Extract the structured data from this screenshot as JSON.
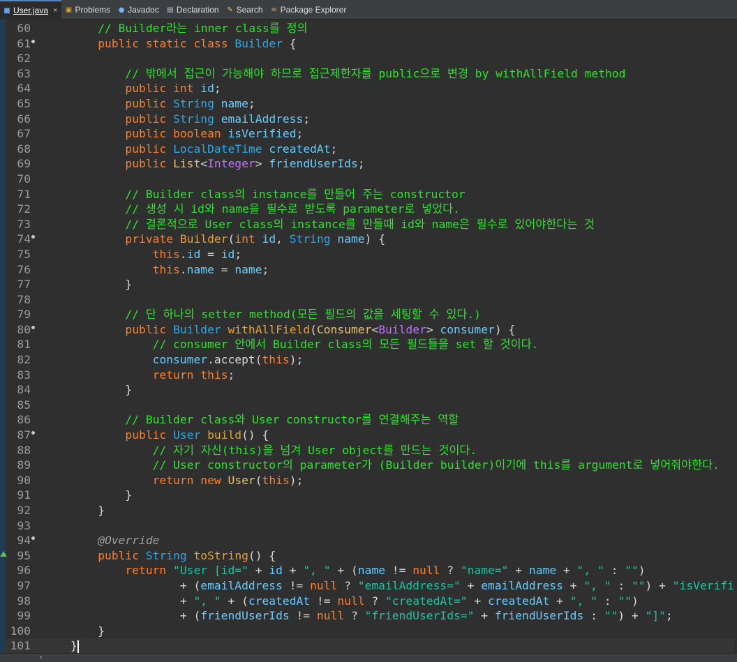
{
  "tabs": [
    {
      "label": "User.java",
      "icon": "java-file-icon",
      "active": true,
      "closable": true
    },
    {
      "label": "Problems",
      "icon": "problems-icon"
    },
    {
      "label": "Javadoc",
      "icon": "javadoc-icon"
    },
    {
      "label": "Declaration",
      "icon": "declaration-icon"
    },
    {
      "label": "Search",
      "icon": "search-icon"
    },
    {
      "label": "Package Explorer",
      "icon": "package-explorer-icon"
    }
  ],
  "colors": {
    "comment": "#30e230",
    "keyword": "#ff7f2a",
    "type": "#2aa9e8",
    "field": "#66ccff",
    "method": "#e8a230",
    "string": "#17c6a3",
    "annotation": "#a0a0a0",
    "generic": "#c070ff",
    "background": "#2f2f2f"
  },
  "editor": {
    "lines": [
      {
        "num": "60",
        "tokens": [
          [
            "    ",
            "p"
          ],
          [
            "// Builder라는 inner class를 정의",
            "cm"
          ]
        ]
      },
      {
        "num": "61",
        "fold": true,
        "tokens": [
          [
            "    ",
            "p"
          ],
          [
            "public",
            "kw"
          ],
          [
            " ",
            "p"
          ],
          [
            "static",
            "kw"
          ],
          [
            " ",
            "p"
          ],
          [
            "class",
            "kw"
          ],
          [
            " ",
            "p"
          ],
          [
            "Builder",
            "ty"
          ],
          [
            " {",
            "p"
          ]
        ]
      },
      {
        "num": "62",
        "tokens": []
      },
      {
        "num": "63",
        "tokens": [
          [
            "        ",
            "p"
          ],
          [
            "// 밖에서 접근이 가능해야 하므로 접근제한자를 public으로 변경 by withAllField method",
            "cm"
          ]
        ]
      },
      {
        "num": "64",
        "tokens": [
          [
            "        ",
            "p"
          ],
          [
            "public",
            "kw"
          ],
          [
            " ",
            "p"
          ],
          [
            "int",
            "kw"
          ],
          [
            " ",
            "p"
          ],
          [
            "id",
            "fd"
          ],
          [
            ";",
            "p"
          ]
        ]
      },
      {
        "num": "65",
        "tokens": [
          [
            "        ",
            "p"
          ],
          [
            "public",
            "kw"
          ],
          [
            " ",
            "p"
          ],
          [
            "String",
            "ty"
          ],
          [
            " ",
            "p"
          ],
          [
            "name",
            "fd"
          ],
          [
            ";",
            "p"
          ]
        ]
      },
      {
        "num": "66",
        "tokens": [
          [
            "        ",
            "p"
          ],
          [
            "public",
            "kw"
          ],
          [
            " ",
            "p"
          ],
          [
            "String",
            "ty"
          ],
          [
            " ",
            "p"
          ],
          [
            "emailAddress",
            "fd"
          ],
          [
            ";",
            "p"
          ]
        ]
      },
      {
        "num": "67",
        "tokens": [
          [
            "        ",
            "p"
          ],
          [
            "public",
            "kw"
          ],
          [
            " ",
            "p"
          ],
          [
            "boolean",
            "kw"
          ],
          [
            " ",
            "p"
          ],
          [
            "isVerified",
            "fd"
          ],
          [
            ";",
            "p"
          ]
        ]
      },
      {
        "num": "68",
        "tokens": [
          [
            "        ",
            "p"
          ],
          [
            "public",
            "kw"
          ],
          [
            " ",
            "p"
          ],
          [
            "LocalDateTime",
            "ty"
          ],
          [
            " ",
            "p"
          ],
          [
            "createdAt",
            "fd"
          ],
          [
            ";",
            "p"
          ]
        ]
      },
      {
        "num": "69",
        "tokens": [
          [
            "        ",
            "p"
          ],
          [
            "public",
            "kw"
          ],
          [
            " ",
            "p"
          ],
          [
            "List",
            "cl"
          ],
          [
            "<",
            "p"
          ],
          [
            "Integer",
            "gn"
          ],
          [
            "> ",
            "p"
          ],
          [
            "friendUserIds",
            "fd"
          ],
          [
            ";",
            "p"
          ]
        ]
      },
      {
        "num": "70",
        "tokens": []
      },
      {
        "num": "71",
        "tokens": [
          [
            "        ",
            "p"
          ],
          [
            "// Builder class의 instance를 만들어 주는 constructor",
            "cm"
          ]
        ]
      },
      {
        "num": "72",
        "tokens": [
          [
            "        ",
            "p"
          ],
          [
            "// 생성 시 id와 name을 필수로 받도록 parameter로 넣었다.",
            "cm"
          ]
        ]
      },
      {
        "num": "73",
        "tokens": [
          [
            "        ",
            "p"
          ],
          [
            "// 결론적으로 User class의 instance를 만들때 id와 name은 필수로 있어야한다는 것",
            "cm"
          ]
        ]
      },
      {
        "num": "74",
        "fold": true,
        "tokens": [
          [
            "        ",
            "p"
          ],
          [
            "private",
            "kw"
          ],
          [
            " ",
            "p"
          ],
          [
            "Builder",
            "fn"
          ],
          [
            "(",
            "p"
          ],
          [
            "int",
            "kw"
          ],
          [
            " ",
            "p"
          ],
          [
            "id",
            "fd"
          ],
          [
            ", ",
            "p"
          ],
          [
            "String",
            "ty"
          ],
          [
            " ",
            "p"
          ],
          [
            "name",
            "fd"
          ],
          [
            ") {",
            "p"
          ]
        ]
      },
      {
        "num": "75",
        "tokens": [
          [
            "            ",
            "p"
          ],
          [
            "this",
            "kw"
          ],
          [
            ".",
            "p"
          ],
          [
            "id",
            "fd"
          ],
          [
            " = ",
            "p"
          ],
          [
            "id",
            "fd"
          ],
          [
            ";",
            "p"
          ]
        ]
      },
      {
        "num": "76",
        "tokens": [
          [
            "            ",
            "p"
          ],
          [
            "this",
            "kw"
          ],
          [
            ".",
            "p"
          ],
          [
            "name",
            "fd"
          ],
          [
            " = ",
            "p"
          ],
          [
            "name",
            "fd"
          ],
          [
            ";",
            "p"
          ]
        ]
      },
      {
        "num": "77",
        "tokens": [
          [
            "        }",
            "p"
          ]
        ]
      },
      {
        "num": "78",
        "tokens": []
      },
      {
        "num": "79",
        "tokens": [
          [
            "        ",
            "p"
          ],
          [
            "// 단 하나의 setter method(모든 필드의 값을 세팅할 수 있다.)",
            "cm"
          ]
        ]
      },
      {
        "num": "80",
        "fold": true,
        "tokens": [
          [
            "        ",
            "p"
          ],
          [
            "public",
            "kw"
          ],
          [
            " ",
            "p"
          ],
          [
            "Builder",
            "ty"
          ],
          [
            " ",
            "p"
          ],
          [
            "withAllField",
            "fn"
          ],
          [
            "(",
            "p"
          ],
          [
            "Consumer",
            "cl"
          ],
          [
            "<",
            "p"
          ],
          [
            "Builder",
            "gn"
          ],
          [
            "> ",
            "p"
          ],
          [
            "consumer",
            "fd"
          ],
          [
            ") {",
            "p"
          ]
        ]
      },
      {
        "num": "81",
        "tokens": [
          [
            "            ",
            "p"
          ],
          [
            "// consumer 안에서 Builder class의 모든 필드들을 set 할 것이다.",
            "cm"
          ]
        ]
      },
      {
        "num": "82",
        "tokens": [
          [
            "            ",
            "p"
          ],
          [
            "consumer",
            "fd"
          ],
          [
            ".accept(",
            "p"
          ],
          [
            "this",
            "kw"
          ],
          [
            ");",
            "p"
          ]
        ]
      },
      {
        "num": "83",
        "tokens": [
          [
            "            ",
            "p"
          ],
          [
            "return",
            "kw"
          ],
          [
            " ",
            "p"
          ],
          [
            "this",
            "kw"
          ],
          [
            ";",
            "p"
          ]
        ]
      },
      {
        "num": "84",
        "tokens": [
          [
            "        }",
            "p"
          ]
        ]
      },
      {
        "num": "85",
        "tokens": []
      },
      {
        "num": "86",
        "tokens": [
          [
            "        ",
            "p"
          ],
          [
            "// Builder class와 User constructor를 연결해주는 역할",
            "cm"
          ]
        ]
      },
      {
        "num": "87",
        "fold": true,
        "tokens": [
          [
            "        ",
            "p"
          ],
          [
            "public",
            "kw"
          ],
          [
            " ",
            "p"
          ],
          [
            "User",
            "ty"
          ],
          [
            " ",
            "p"
          ],
          [
            "build",
            "fn"
          ],
          [
            "() {",
            "p"
          ]
        ]
      },
      {
        "num": "88",
        "tokens": [
          [
            "            ",
            "p"
          ],
          [
            "// 자기 자신(this)을 넘겨 User object를 만드는 것이다.",
            "cm"
          ]
        ]
      },
      {
        "num": "89",
        "tokens": [
          [
            "            ",
            "p"
          ],
          [
            "// User constructor의 parameter가 (Builder builder)이기에 this를 argument로 넣어줘야한다.",
            "cm"
          ]
        ]
      },
      {
        "num": "90",
        "tokens": [
          [
            "            ",
            "p"
          ],
          [
            "return",
            "kw"
          ],
          [
            " ",
            "p"
          ],
          [
            "new",
            "kw"
          ],
          [
            " ",
            "p"
          ],
          [
            "User",
            "cl"
          ],
          [
            "(",
            "p"
          ],
          [
            "this",
            "kw"
          ],
          [
            ");",
            "p"
          ]
        ]
      },
      {
        "num": "91",
        "tokens": [
          [
            "        }",
            "p"
          ]
        ]
      },
      {
        "num": "92",
        "tokens": [
          [
            "    }",
            "p"
          ]
        ]
      },
      {
        "num": "93",
        "tokens": []
      },
      {
        "num": "94",
        "fold": true,
        "tokens": [
          [
            "    ",
            "p"
          ],
          [
            "@Override",
            "an"
          ]
        ]
      },
      {
        "num": "95",
        "override": true,
        "tokens": [
          [
            "    ",
            "p"
          ],
          [
            "public",
            "kw"
          ],
          [
            " ",
            "p"
          ],
          [
            "String",
            "ty"
          ],
          [
            " ",
            "p"
          ],
          [
            "toString",
            "fn"
          ],
          [
            "() {",
            "p"
          ]
        ]
      },
      {
        "num": "96",
        "tokens": [
          [
            "        ",
            "p"
          ],
          [
            "return",
            "kw"
          ],
          [
            " ",
            "p"
          ],
          [
            "\"User [id=\"",
            "st"
          ],
          [
            " + ",
            "p"
          ],
          [
            "id",
            "fd"
          ],
          [
            " + ",
            "p"
          ],
          [
            "\", \"",
            "st"
          ],
          [
            " + (",
            "p"
          ],
          [
            "name",
            "fd"
          ],
          [
            " != ",
            "p"
          ],
          [
            "null",
            "kw"
          ],
          [
            " ? ",
            "p"
          ],
          [
            "\"name=\"",
            "st"
          ],
          [
            " + ",
            "p"
          ],
          [
            "name",
            "fd"
          ],
          [
            " + ",
            "p"
          ],
          [
            "\", \"",
            "st"
          ],
          [
            " : ",
            "p"
          ],
          [
            "\"\"",
            "st"
          ],
          [
            ")",
            "p"
          ]
        ]
      },
      {
        "num": "97",
        "tokens": [
          [
            "                ",
            "p"
          ],
          [
            "+ (",
            "p"
          ],
          [
            "emailAddress",
            "fd"
          ],
          [
            " != ",
            "p"
          ],
          [
            "null",
            "kw"
          ],
          [
            " ? ",
            "p"
          ],
          [
            "\"emailAddress=\"",
            "st"
          ],
          [
            " + ",
            "p"
          ],
          [
            "emailAddress",
            "fd"
          ],
          [
            " + ",
            "p"
          ],
          [
            "\", \"",
            "st"
          ],
          [
            " : ",
            "p"
          ],
          [
            "\"\"",
            "st"
          ],
          [
            ") + ",
            "p"
          ],
          [
            "\"isVerifi",
            "st"
          ]
        ]
      },
      {
        "num": "98",
        "tokens": [
          [
            "                ",
            "p"
          ],
          [
            "+ ",
            "p"
          ],
          [
            "\", \"",
            "st"
          ],
          [
            " + (",
            "p"
          ],
          [
            "createdAt",
            "fd"
          ],
          [
            " != ",
            "p"
          ],
          [
            "null",
            "kw"
          ],
          [
            " ? ",
            "p"
          ],
          [
            "\"createdAt=\"",
            "st"
          ],
          [
            " + ",
            "p"
          ],
          [
            "createdAt",
            "fd"
          ],
          [
            " + ",
            "p"
          ],
          [
            "\", \"",
            "st"
          ],
          [
            " : ",
            "p"
          ],
          [
            "\"\"",
            "st"
          ],
          [
            ")",
            "p"
          ]
        ]
      },
      {
        "num": "99",
        "tokens": [
          [
            "                ",
            "p"
          ],
          [
            "+ (",
            "p"
          ],
          [
            "friendUserIds",
            "fd"
          ],
          [
            " != ",
            "p"
          ],
          [
            "null",
            "kw"
          ],
          [
            " ? ",
            "p"
          ],
          [
            "\"friendUserIds=\"",
            "st"
          ],
          [
            " + ",
            "p"
          ],
          [
            "friendUserIds",
            "fd"
          ],
          [
            " : ",
            "p"
          ],
          [
            "\"\"",
            "st"
          ],
          [
            ") + ",
            "p"
          ],
          [
            "\"]\"",
            "st"
          ],
          [
            ";",
            "p"
          ]
        ]
      },
      {
        "num": "100",
        "tokens": [
          [
            "    }",
            "p"
          ]
        ]
      },
      {
        "num": "101",
        "current": true,
        "tokens": [
          [
            "}",
            "p"
          ]
        ]
      }
    ]
  }
}
